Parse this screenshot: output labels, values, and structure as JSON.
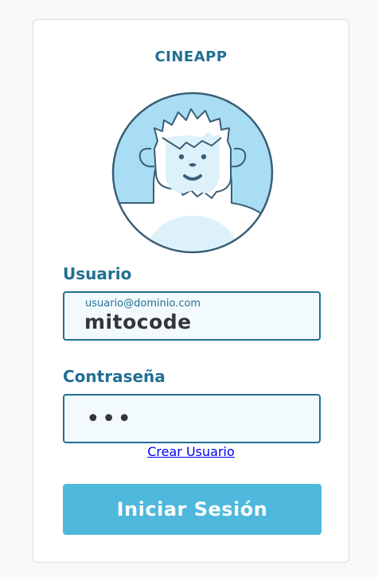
{
  "app": {
    "title": "CINEAPP"
  },
  "avatar": {
    "icon": "yeti-avatar-icon",
    "colors": {
      "background": "#a9ddf3",
      "outline": "#3a5e77",
      "face": "#ddf1fa",
      "body": "#ffffff"
    }
  },
  "form": {
    "username": {
      "label": "Usuario",
      "helper": "usuario@dominio.com",
      "value": "mitocode"
    },
    "password": {
      "label": "Contraseña",
      "value": "•••"
    },
    "create_link": "Crear Usuario",
    "submit_label": "Iniciar Sesión"
  },
  "colors": {
    "accent": "#217093",
    "button": "#4eb8dd",
    "field_bg": "#f3fafd",
    "text": "#353538"
  }
}
